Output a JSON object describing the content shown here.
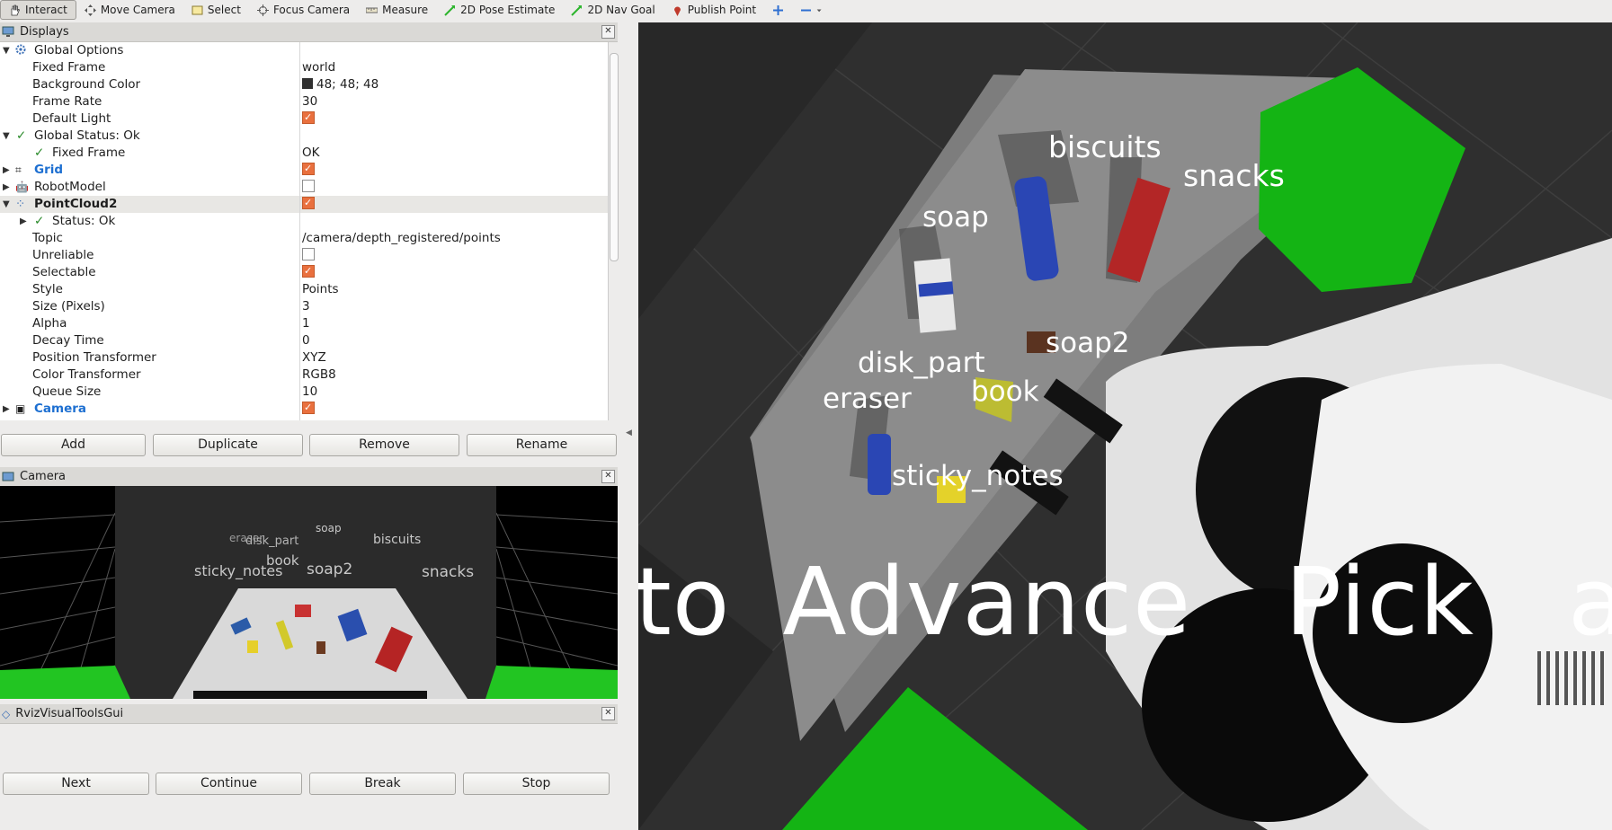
{
  "toolbar": {
    "tools": [
      {
        "label": "Interact",
        "icon": "hand-icon"
      },
      {
        "label": "Move Camera",
        "icon": "move-camera-icon"
      },
      {
        "label": "Select",
        "icon": "select-icon"
      },
      {
        "label": "Focus Camera",
        "icon": "focus-camera-icon"
      },
      {
        "label": "Measure",
        "icon": "measure-icon"
      },
      {
        "label": "2D Pose Estimate",
        "icon": "pose-estimate-icon"
      },
      {
        "label": "2D Nav Goal",
        "icon": "nav-goal-icon"
      },
      {
        "label": "Publish Point",
        "icon": "publish-point-icon"
      }
    ]
  },
  "displays": {
    "title": "Displays",
    "rows": [
      {
        "label": "Global Options",
        "value": ""
      },
      {
        "label": "Fixed Frame",
        "value": "world"
      },
      {
        "label": "Background Color",
        "value": "48; 48; 48"
      },
      {
        "label": "Frame Rate",
        "value": "30"
      },
      {
        "label": "Default Light",
        "value": ""
      },
      {
        "label": "Global Status: Ok",
        "value": ""
      },
      {
        "label": "Fixed Frame",
        "value": "OK"
      },
      {
        "label": "Grid",
        "value": ""
      },
      {
        "label": "RobotModel",
        "value": ""
      },
      {
        "label": "PointCloud2",
        "value": ""
      },
      {
        "label": "Status: Ok",
        "value": ""
      },
      {
        "label": "Topic",
        "value": "/camera/depth_registered/points"
      },
      {
        "label": "Unreliable",
        "value": ""
      },
      {
        "label": "Selectable",
        "value": ""
      },
      {
        "label": "Style",
        "value": "Points"
      },
      {
        "label": "Size (Pixels)",
        "value": "3"
      },
      {
        "label": "Alpha",
        "value": "1"
      },
      {
        "label": "Decay Time",
        "value": "0"
      },
      {
        "label": "Position Transformer",
        "value": "XYZ"
      },
      {
        "label": "Color Transformer",
        "value": "RGB8"
      },
      {
        "label": "Queue Size",
        "value": "10"
      },
      {
        "label": "Camera",
        "value": ""
      }
    ],
    "buttons": {
      "add": "Add",
      "duplicate": "Duplicate",
      "remove": "Remove",
      "rename": "Rename"
    }
  },
  "camera_panel": {
    "title": "Camera",
    "labels": [
      "eraser",
      "disk_part",
      "soap",
      "biscuits",
      "book",
      "sticky_notes",
      "soap2",
      "snacks"
    ]
  },
  "rviz_gui": {
    "title": "RvizVisualToolsGui",
    "buttons": {
      "next": "Next",
      "continue": "Continue",
      "break": "Break",
      "stop": "Stop"
    }
  },
  "scene": {
    "labels": {
      "biscuits": "biscuits",
      "snacks": "snacks",
      "soap": "soap",
      "soap2": "soap2",
      "disk_part": "disk_part",
      "eraser": "eraser",
      "book": "book",
      "sticky_notes": "sticky_notes"
    },
    "banner_words": [
      "to",
      "Advance",
      "Pick",
      "ar"
    ],
    "background_color": "#303030"
  }
}
